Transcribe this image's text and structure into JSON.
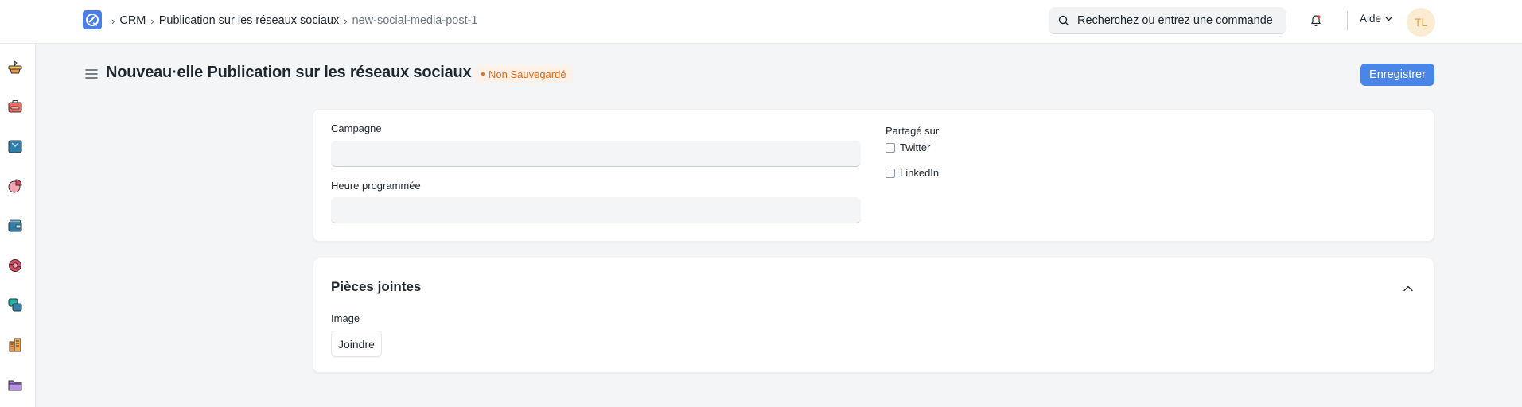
{
  "navbar": {
    "breadcrumbs": [
      {
        "label": "CRM"
      },
      {
        "label": "Publication sur les réseaux sociaux"
      },
      {
        "label": "new-social-media-post-1"
      }
    ],
    "search_placeholder": "Recherchez ou entrez une commande",
    "help_label": "Aide",
    "avatar_initials": "TL"
  },
  "sidebar": {
    "icons": [
      "basket-icon",
      "briefcase-icon",
      "folder-icon",
      "pie-chart-icon",
      "wallet-icon",
      "support-icon",
      "chat-icon",
      "building-icon",
      "archive-icon"
    ]
  },
  "page": {
    "title": "Nouveau·elle Publication sur les réseaux sociaux",
    "status": "Non Sauvegardé",
    "save_label": "Enregistrer"
  },
  "form": {
    "campaign_label": "Campagne",
    "campaign_value": "",
    "scheduled_time_label": "Heure programmée",
    "scheduled_time_value": "",
    "share_on_label": "Partagé sur",
    "share_options": [
      {
        "label": "Twitter",
        "checked": false
      },
      {
        "label": "LinkedIn",
        "checked": false
      }
    ]
  },
  "attachments": {
    "section_title": "Pièces jointes",
    "image_label": "Image",
    "attach_label": "Joindre"
  },
  "colors": {
    "primary": "#4a86e8",
    "status_orange": "#e86c13",
    "status_bg": "#fff1e7",
    "page_bg": "#f3f5f7"
  }
}
